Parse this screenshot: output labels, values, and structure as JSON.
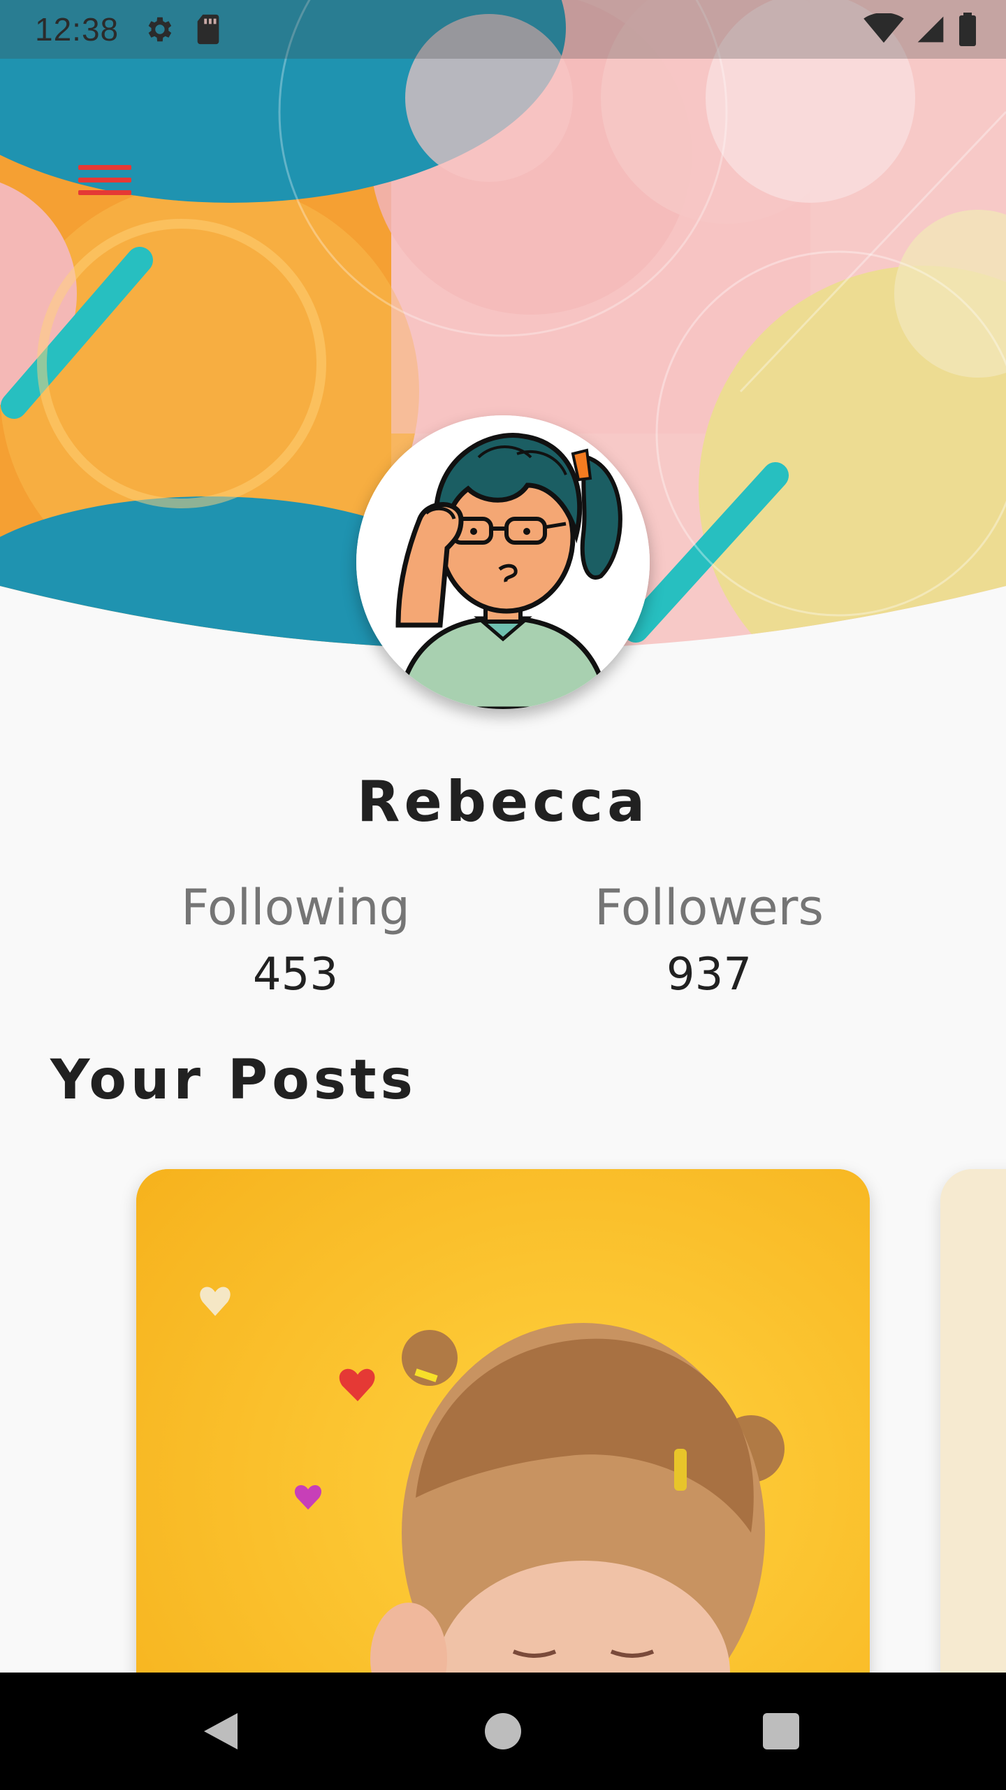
{
  "status_bar": {
    "time": "12:38",
    "icons_left": [
      "gear-icon",
      "sd-card-icon"
    ],
    "icons_right": [
      "wifi-icon",
      "signal-icon",
      "battery-icon"
    ]
  },
  "header": {
    "menu_icon": "hamburger-menu-icon",
    "colors": {
      "teal": "#1f93b0",
      "orange": "#f5a033",
      "pink": "#f4b8b6",
      "cream": "#eddc92",
      "accent_red": "#e53935"
    }
  },
  "profile": {
    "name": "Rebecca",
    "stats": [
      {
        "label": "Following",
        "value": "453"
      },
      {
        "label": "Followers",
        "value": "937"
      }
    ]
  },
  "posts": {
    "section_title": "Your Posts"
  },
  "nav_bar": {
    "buttons": [
      "back-icon",
      "home-icon",
      "recents-icon"
    ]
  }
}
